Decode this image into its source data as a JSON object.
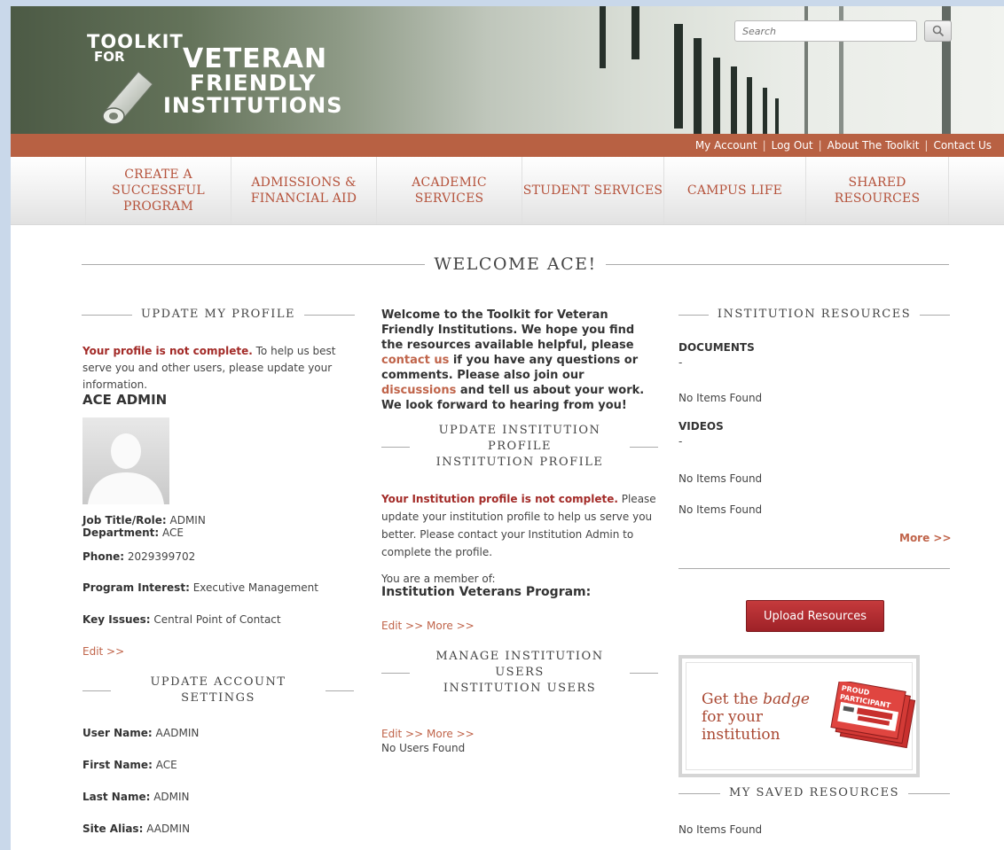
{
  "site": {
    "logo": {
      "line1": "TOOLKIT",
      "line2": "FOR",
      "line3": "VETERAN",
      "line4": "FRIENDLY",
      "line5": "INSTITUTIONS"
    },
    "search": {
      "placeholder": "Search",
      "icon": "magnifier"
    }
  },
  "utility_nav": [
    "My Account",
    "Log Out",
    "About The Toolkit",
    "Contact Us"
  ],
  "main_nav": [
    "CREATE A SUCCESSFUL PROGRAM",
    "ADMISSIONS & FINANCIAL AID",
    "ACADEMIC SERVICES",
    "STUDENT SERVICES",
    "CAMPUS LIFE",
    "SHARED RESOURCES"
  ],
  "welcome_title": "WELCOME ACE!",
  "left": {
    "heading": "UPDATE MY PROFILE",
    "incomplete_label": "Your profile is not complete.",
    "incomplete_text": " To help us best serve you and other users, please update your information.",
    "name": "ACE ADMIN",
    "job_title_label": "Job Title/Role:",
    "job_title": " ADMIN",
    "department_label": "Department:",
    "department": " ACE",
    "phone_label": "Phone:",
    "phone": " 2029399702",
    "program_interest_label": "Program Interest:",
    "program_interest": " Executive Management",
    "key_issues_label": "Key Issues:",
    "key_issues": " Central Point of Contact",
    "edit_link": "Edit >>",
    "account_heading": "UPDATE ACCOUNT SETTINGS",
    "username_label": "User Name:",
    "username": " AADMIN",
    "first_name_label": "First Name:",
    "first_name": " ACE",
    "last_name_label": "Last Name:",
    "last_name": " ADMIN",
    "alias_label": "Site Alias:",
    "alias": " AADMIN"
  },
  "center": {
    "welcome_p1": "Welcome to the Toolkit for Veteran Friendly Institutions. We hope you find the resources available helpful, please ",
    "contact_link": "contact us",
    "welcome_p2": " if you have any questions or comments. Please also join our ",
    "discussions_link": "discussions",
    "welcome_p3": " and tell us about your work. We look forward to hearing from you!",
    "inst_heading_1": "UPDATE INSTITUTION",
    "inst_heading_2": "PROFILE",
    "inst_heading_3": "INSTITUTION PROFILE",
    "inst_incomplete_label": "Your Institution profile is not complete.",
    "inst_incomplete_text": " Please update your institution profile to help us serve you better. Please contact your Institution Admin to complete the profile.",
    "member_of": "You are a member of:",
    "program_name": "Institution Veterans Program:",
    "edit_link": "Edit >>",
    "more_link": "More >>",
    "users_heading_1": "MANAGE INSTITUTION",
    "users_heading_2": "USERS",
    "users_heading_3": "INSTITUTION USERS",
    "users_edit_link": "Edit >>",
    "users_more_link": "More >>",
    "no_users": "No Users Found"
  },
  "right": {
    "heading": "INSTITUTION RESOURCES",
    "documents_label": "DOCUMENTS",
    "dash": "-",
    "docs_none": "No Items Found",
    "videos_label": "VIDEOS",
    "videos_none": "No Items Found",
    "extra_none": "No Items Found",
    "more_link": "More >>",
    "upload_button": "Upload Resources",
    "badge": {
      "line1": "Get the ",
      "line1_em": "badge",
      "line2": "for your",
      "line3": "institution",
      "seal_line1": "PROUD",
      "seal_line2": "PARTICIPANT"
    },
    "saved_heading": "MY SAVED RESOURCES",
    "saved_none": "No Items Found"
  },
  "colors": {
    "accent": "#b86143",
    "link": "#c0644a",
    "warning": "#a32b28",
    "button": "#b3292d",
    "page_bg": "#c9d8ea"
  }
}
